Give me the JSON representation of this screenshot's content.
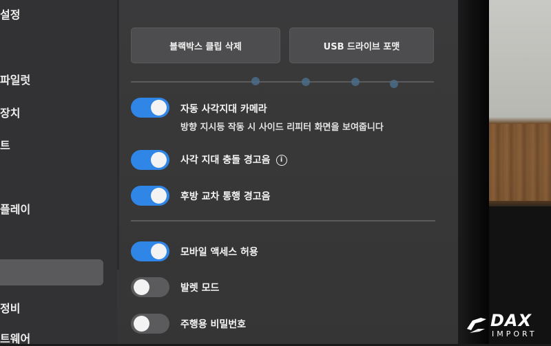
{
  "sidebar": {
    "items": [
      {
        "label": "설정"
      },
      {
        "label": "파일럿"
      },
      {
        "label": "장치"
      },
      {
        "label": "트"
      },
      {
        "label": "플레이"
      },
      {
        "label": ""
      },
      {
        "label": "정비"
      },
      {
        "label": "트웨어"
      }
    ]
  },
  "actions": {
    "delete_clips": "블랙박스 클립 삭제",
    "format_usb": "USB 드라이브 포맷"
  },
  "settings": [
    {
      "label": "자동 사각지대 카메라",
      "description": "방향 지시등 작동 시 사이드 리피터 화면을 보여줍니다",
      "enabled": true
    },
    {
      "label": "사각 지대 충돌 경고음",
      "has_info": true,
      "enabled": true
    },
    {
      "label": "후방 교차 통행 경고음",
      "enabled": true
    },
    {
      "label": "모바일 액세스 허용",
      "enabled": true
    },
    {
      "label": "발렛 모드",
      "enabled": false
    },
    {
      "label": "주행용 비밀번호",
      "enabled": false
    }
  ],
  "icons": {
    "info": "info-icon"
  },
  "colors": {
    "toggle_on": "#2f86e6",
    "toggle_off": "#5b5b5d"
  },
  "watermark": {
    "brand": "DAX",
    "sub": "IMPORT"
  }
}
